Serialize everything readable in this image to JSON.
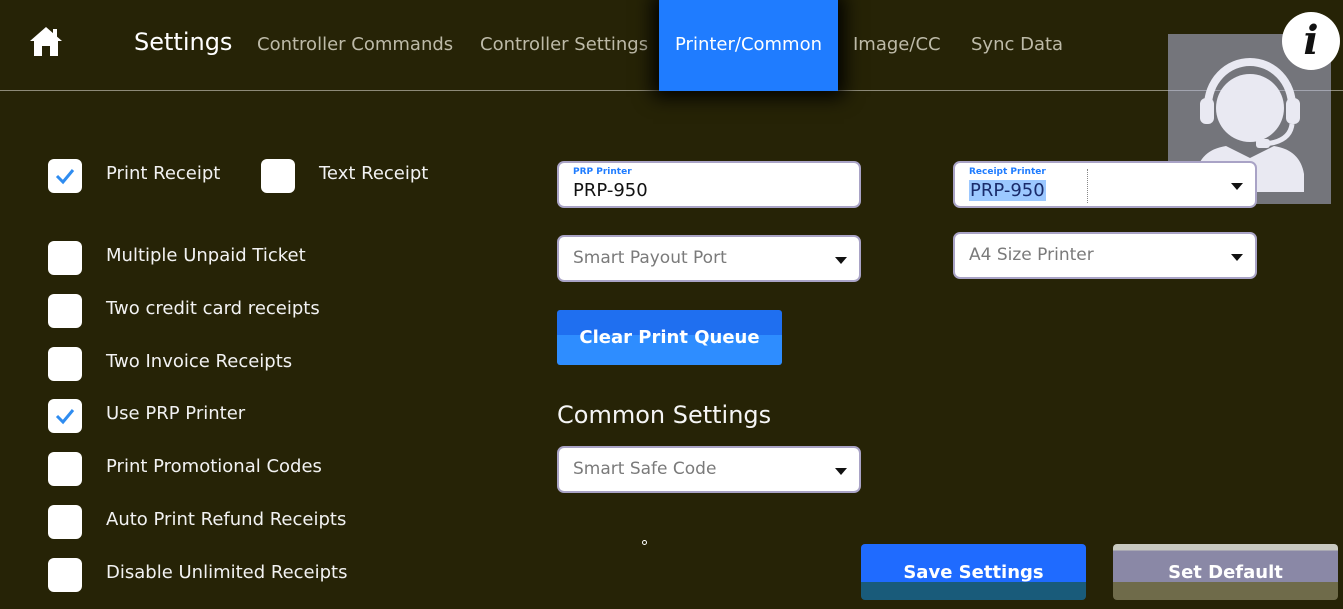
{
  "header": {
    "title": "Settings",
    "tabs": [
      {
        "label": "Controller Commands",
        "active": false
      },
      {
        "label": "Controller Settings",
        "active": false
      },
      {
        "label": "Printer/Common",
        "active": true
      },
      {
        "label": "Image/CC",
        "active": false
      },
      {
        "label": "Sync Data",
        "active": false
      }
    ],
    "info_glyph": "i"
  },
  "checkboxes": {
    "print_receipt": {
      "label": "Print Receipt",
      "checked": true
    },
    "text_receipt": {
      "label": "Text Receipt",
      "checked": false
    },
    "multiple_unpaid": {
      "label": "Multiple Unpaid Ticket",
      "checked": false
    },
    "two_cc": {
      "label": "Two credit card receipts",
      "checked": false
    },
    "two_invoice": {
      "label": "Two Invoice Receipts",
      "checked": false
    },
    "use_prp": {
      "label": "Use PRP Printer",
      "checked": true
    },
    "promo_codes": {
      "label": "Print Promotional Codes",
      "checked": false
    },
    "auto_refund": {
      "label": "Auto Print Refund Receipts",
      "checked": false
    },
    "disable_unlimited": {
      "label": "Disable Unlimited Receipts",
      "checked": false
    }
  },
  "fields": {
    "prp_printer": {
      "label": "PRP Printer",
      "value": "PRP-950"
    },
    "receipt_printer": {
      "label": "Receipt Printer",
      "value": "PRP-950"
    },
    "smart_payout_port": {
      "placeholder": "Smart Payout Port"
    },
    "a4_printer": {
      "placeholder": "A4 Size Printer"
    },
    "smart_safe_code": {
      "placeholder": "Smart Safe Code"
    }
  },
  "buttons": {
    "clear_queue": "Clear Print Queue",
    "save": "Save Settings",
    "set_default": "Set Default"
  },
  "common": {
    "title": "Common Settings"
  },
  "colors": {
    "background": "#262306",
    "accent": "#1f7cff",
    "tab_inactive": "#bdbaa8"
  },
  "icons": [
    "home-icon",
    "info-icon",
    "support-agent-icon",
    "check-icon",
    "chevron-down-icon"
  ]
}
